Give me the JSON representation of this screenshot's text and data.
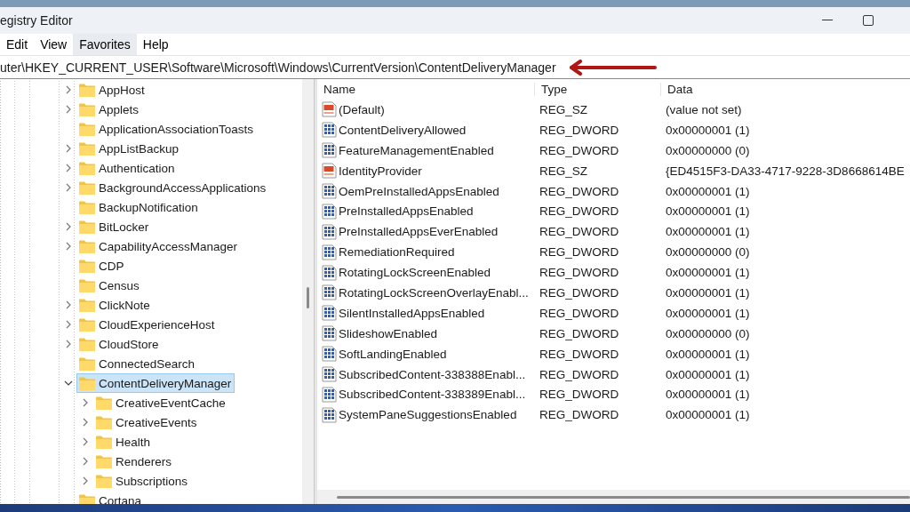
{
  "window": {
    "title": "egistry Editor"
  },
  "menu": [
    {
      "label": "Edit",
      "selected": false
    },
    {
      "label": "View",
      "selected": false
    },
    {
      "label": "Favorites",
      "selected": true
    },
    {
      "label": "Help",
      "selected": false
    }
  ],
  "address": "uter\\HKEY_CURRENT_USER\\Software\\Microsoft\\Windows\\CurrentVersion\\ContentDeliveryManager",
  "tree": [
    {
      "label": "AppHost",
      "expandable": true,
      "expanded": false,
      "selected": false
    },
    {
      "label": "Applets",
      "expandable": true,
      "expanded": false,
      "selected": false
    },
    {
      "label": "ApplicationAssociationToasts",
      "expandable": false,
      "selected": false
    },
    {
      "label": "AppListBackup",
      "expandable": true,
      "expanded": false,
      "selected": false
    },
    {
      "label": "Authentication",
      "expandable": true,
      "expanded": false,
      "selected": false
    },
    {
      "label": "BackgroundAccessApplications",
      "expandable": true,
      "expanded": false,
      "selected": false
    },
    {
      "label": "BackupNotification",
      "expandable": false,
      "selected": false
    },
    {
      "label": "BitLocker",
      "expandable": true,
      "expanded": false,
      "selected": false
    },
    {
      "label": "CapabilityAccessManager",
      "expandable": true,
      "expanded": false,
      "selected": false
    },
    {
      "label": "CDP",
      "expandable": false,
      "selected": false
    },
    {
      "label": "Census",
      "expandable": false,
      "selected": false
    },
    {
      "label": "ClickNote",
      "expandable": true,
      "expanded": false,
      "selected": false
    },
    {
      "label": "CloudExperienceHost",
      "expandable": true,
      "expanded": false,
      "selected": false
    },
    {
      "label": "CloudStore",
      "expandable": true,
      "expanded": false,
      "selected": false
    },
    {
      "label": "ConnectedSearch",
      "expandable": false,
      "selected": false
    },
    {
      "label": "ContentDeliveryManager",
      "expandable": true,
      "expanded": true,
      "selected": true,
      "children": [
        {
          "label": "CreativeEventCache",
          "expandable": true,
          "expanded": false,
          "selected": false
        },
        {
          "label": "CreativeEvents",
          "expandable": true,
          "expanded": false,
          "selected": false
        },
        {
          "label": "Health",
          "expandable": true,
          "expanded": false,
          "selected": false
        },
        {
          "label": "Renderers",
          "expandable": true,
          "expanded": false,
          "selected": false
        },
        {
          "label": "Subscriptions",
          "expandable": true,
          "expanded": false,
          "selected": false
        }
      ]
    },
    {
      "label": "Cortana",
      "expandable": false,
      "selected": false
    }
  ],
  "values": {
    "columns": [
      "Name",
      "Type",
      "Data"
    ],
    "rows": [
      {
        "kind": "string",
        "name": "(Default)",
        "type": "REG_SZ",
        "data": "(value not set)"
      },
      {
        "kind": "binary",
        "name": "ContentDeliveryAllowed",
        "type": "REG_DWORD",
        "data": "0x00000001 (1)"
      },
      {
        "kind": "binary",
        "name": "FeatureManagementEnabled",
        "type": "REG_DWORD",
        "data": "0x00000000 (0)"
      },
      {
        "kind": "string",
        "name": "IdentityProvider",
        "type": "REG_SZ",
        "data": "{ED4515F3-DA33-4717-9228-3D8668614BE"
      },
      {
        "kind": "binary",
        "name": "OemPreInstalledAppsEnabled",
        "type": "REG_DWORD",
        "data": "0x00000001 (1)"
      },
      {
        "kind": "binary",
        "name": "PreInstalledAppsEnabled",
        "type": "REG_DWORD",
        "data": "0x00000001 (1)"
      },
      {
        "kind": "binary",
        "name": "PreInstalledAppsEverEnabled",
        "type": "REG_DWORD",
        "data": "0x00000001 (1)"
      },
      {
        "kind": "binary",
        "name": "RemediationRequired",
        "type": "REG_DWORD",
        "data": "0x00000000 (0)"
      },
      {
        "kind": "binary",
        "name": "RotatingLockScreenEnabled",
        "type": "REG_DWORD",
        "data": "0x00000001 (1)"
      },
      {
        "kind": "binary",
        "name": "RotatingLockScreenOverlayEnabl...",
        "type": "REG_DWORD",
        "data": "0x00000001 (1)"
      },
      {
        "kind": "binary",
        "name": "SilentInstalledAppsEnabled",
        "type": "REG_DWORD",
        "data": "0x00000001 (1)"
      },
      {
        "kind": "binary",
        "name": "SlideshowEnabled",
        "type": "REG_DWORD",
        "data": "0x00000000 (0)"
      },
      {
        "kind": "binary",
        "name": "SoftLandingEnabled",
        "type": "REG_DWORD",
        "data": "0x00000001 (1)"
      },
      {
        "kind": "binary",
        "name": "SubscribedContent-338388Enabl...",
        "type": "REG_DWORD",
        "data": "0x00000001 (1)"
      },
      {
        "kind": "binary",
        "name": "SubscribedContent-338389Enabl...",
        "type": "REG_DWORD",
        "data": "0x00000001 (1)"
      },
      {
        "kind": "binary",
        "name": "SystemPaneSuggestionsEnabled",
        "type": "REG_DWORD",
        "data": "0x00000001 (1)"
      }
    ]
  }
}
